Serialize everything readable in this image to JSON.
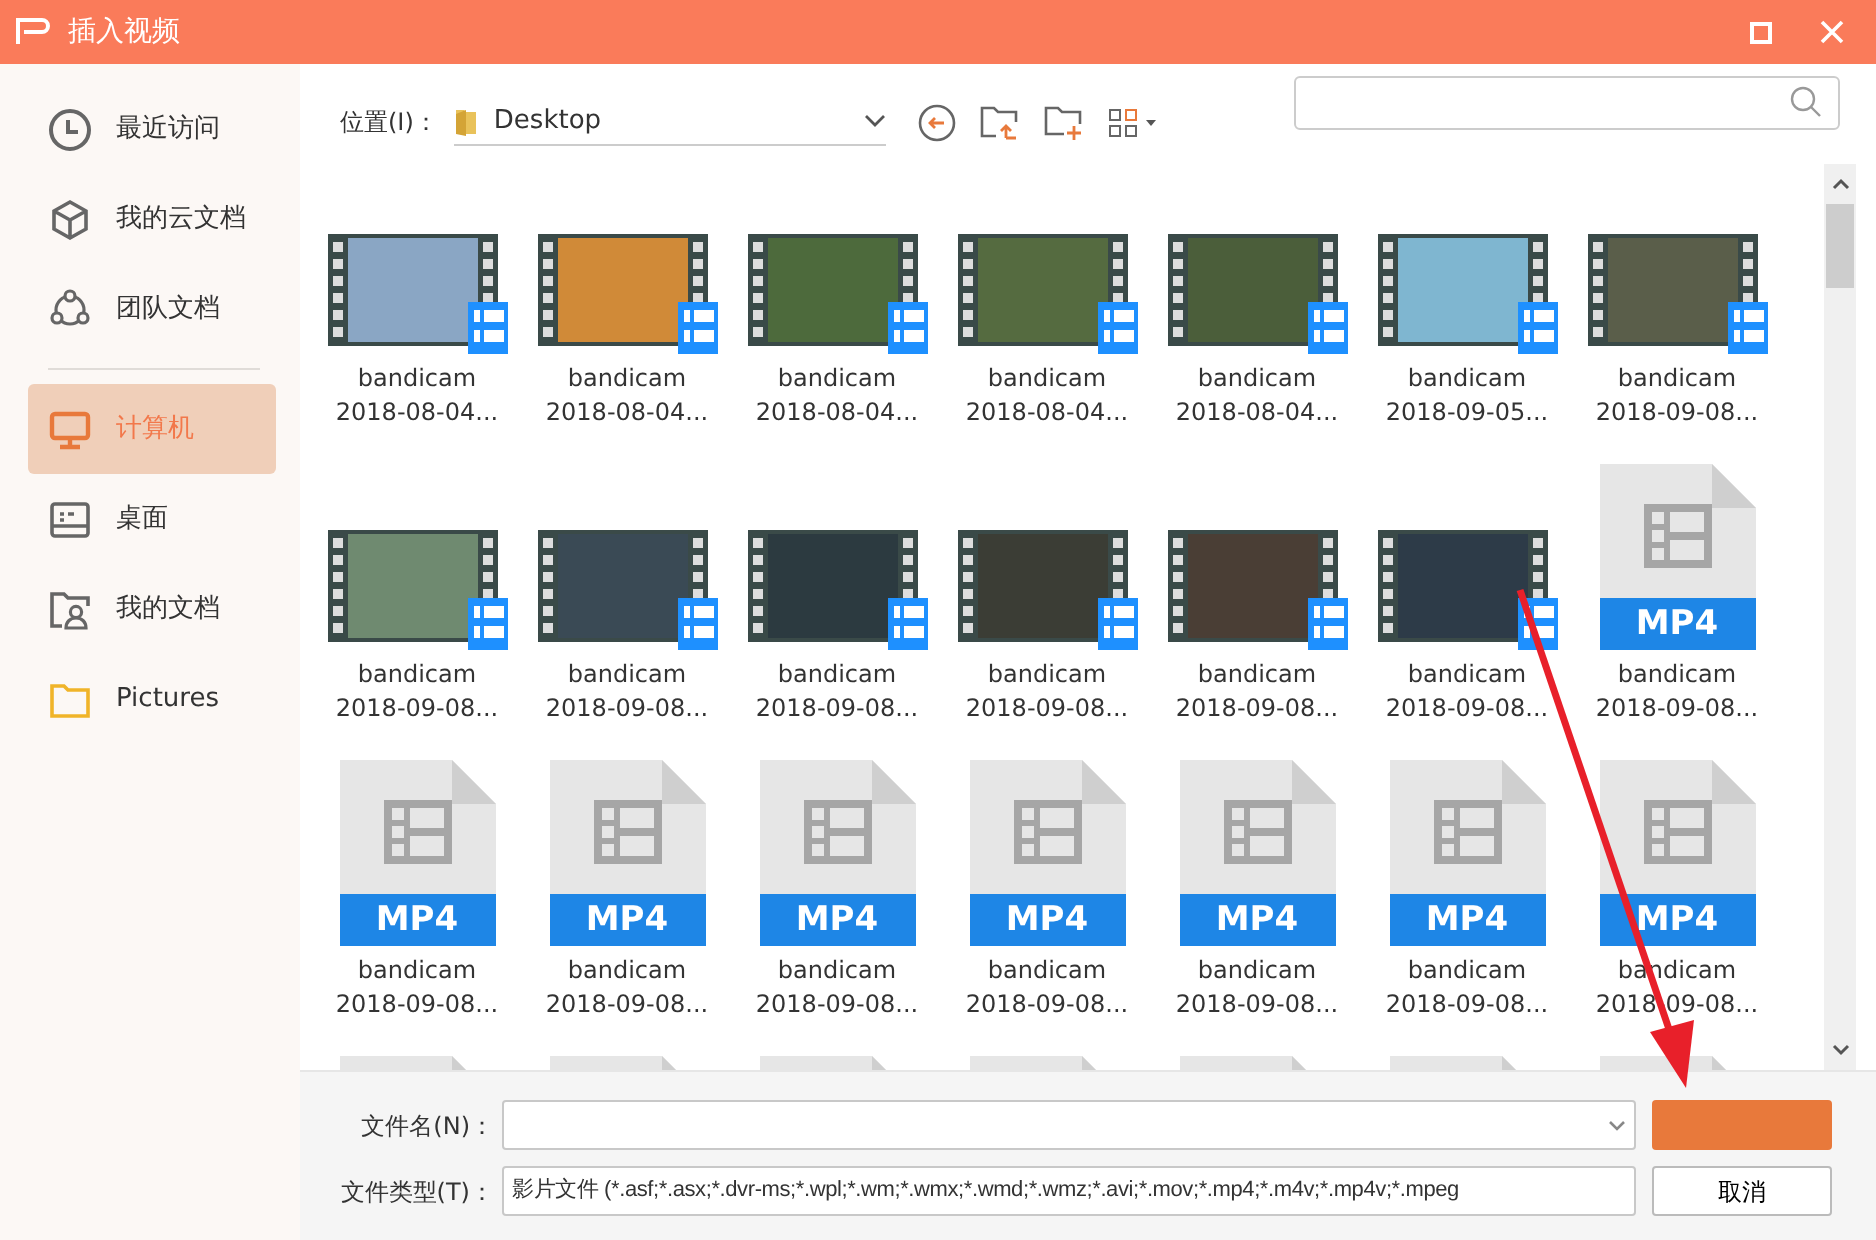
{
  "window": {
    "title": "插入视频"
  },
  "sidebar": {
    "items": [
      {
        "label": "最近访问",
        "selected": false
      },
      {
        "label": "我的云文档",
        "selected": false
      },
      {
        "label": "团队文档",
        "selected": false
      },
      {
        "label": "计算机",
        "selected": true
      },
      {
        "label": "桌面",
        "selected": false
      },
      {
        "label": "我的文档",
        "selected": false
      },
      {
        "label": "Pictures",
        "selected": false
      }
    ]
  },
  "toolbar": {
    "location_label": "位置(I)：",
    "location": "Desktop"
  },
  "files": [
    {
      "kind": "video",
      "name": "bandicam",
      "date": "2018-08-04..."
    },
    {
      "kind": "video",
      "name": "bandicam",
      "date": "2018-08-04..."
    },
    {
      "kind": "video",
      "name": "bandicam",
      "date": "2018-08-04..."
    },
    {
      "kind": "video",
      "name": "bandicam",
      "date": "2018-08-04..."
    },
    {
      "kind": "video",
      "name": "bandicam",
      "date": "2018-08-04..."
    },
    {
      "kind": "video",
      "name": "bandicam",
      "date": "2018-09-05..."
    },
    {
      "kind": "video",
      "name": "bandicam",
      "date": "2018-09-08..."
    },
    {
      "kind": "video",
      "name": "bandicam",
      "date": "2018-09-08..."
    },
    {
      "kind": "video",
      "name": "bandicam",
      "date": "2018-09-08..."
    },
    {
      "kind": "video",
      "name": "bandicam",
      "date": "2018-09-08..."
    },
    {
      "kind": "video",
      "name": "bandicam",
      "date": "2018-09-08..."
    },
    {
      "kind": "video",
      "name": "bandicam",
      "date": "2018-09-08..."
    },
    {
      "kind": "video",
      "name": "bandicam",
      "date": "2018-09-08..."
    },
    {
      "kind": "mp4",
      "badge": "MP4",
      "name": "bandicam",
      "date": "2018-09-08..."
    },
    {
      "kind": "mp4",
      "badge": "MP4",
      "name": "bandicam",
      "date": "2018-09-08..."
    },
    {
      "kind": "mp4",
      "badge": "MP4",
      "name": "bandicam",
      "date": "2018-09-08..."
    },
    {
      "kind": "mp4",
      "badge": "MP4",
      "name": "bandicam",
      "date": "2018-09-08..."
    },
    {
      "kind": "mp4",
      "badge": "MP4",
      "name": "bandicam",
      "date": "2018-09-08..."
    },
    {
      "kind": "mp4",
      "badge": "MP4",
      "name": "bandicam",
      "date": "2018-09-08..."
    },
    {
      "kind": "mp4",
      "badge": "MP4",
      "name": "bandicam",
      "date": "2018-09-08..."
    },
    {
      "kind": "mp4",
      "badge": "MP4",
      "name": "bandicam",
      "date": "2018-09-08..."
    },
    {
      "kind": "mp4"
    },
    {
      "kind": "mp4"
    },
    {
      "kind": "mp4"
    },
    {
      "kind": "mp4"
    },
    {
      "kind": "mp4"
    },
    {
      "kind": "mp4"
    },
    {
      "kind": "mp4"
    }
  ],
  "footer": {
    "filename_label": "文件名(N)：",
    "filetype_label": "文件类型(T)：",
    "filetype": "影片文件 (*.asf;*.asx;*.dvr-ms;*.wpl;*.wm;*.wmx;*.wmd;*.wmz;*.avi;*.mov;*.mp4;*.m4v;*.mp4v;*.mpeg",
    "cancel": "取消"
  },
  "annotation_arrow": true
}
